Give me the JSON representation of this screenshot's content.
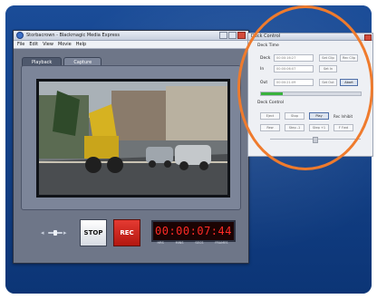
{
  "app": {
    "title": "Storbacrown - Blackmagic Media Express",
    "menu": [
      "File",
      "Edit",
      "View",
      "Movie",
      "Help"
    ],
    "tabs": [
      {
        "label": "Playback",
        "active": false
      },
      {
        "label": "Capture",
        "active": true
      }
    ]
  },
  "transport": {
    "stop_label": "STOP",
    "rec_label": "REC",
    "timecode": "00:00:07:44",
    "tc_labels": [
      "HRS",
      "MINS",
      "SECS",
      "FRAMES"
    ]
  },
  "deck": {
    "title": "Deck Control",
    "deck_time_header": "Deck Time",
    "deck_control_header": "Deck Control",
    "rows": [
      {
        "label": "Deck",
        "value": "00:00:16:27",
        "buttons": [
          "Set Clip",
          "Rec Clip"
        ]
      },
      {
        "label": "In",
        "value": "00:00:06:07",
        "buttons": [
          "Set In"
        ]
      },
      {
        "label": "Out",
        "value": "00:00:21:09",
        "buttons": [
          "Set Out",
          "Abort"
        ]
      }
    ],
    "progress": 0.22,
    "control_buttons_row1": [
      "Eject",
      "Stop",
      "Play"
    ],
    "rec_inhibit": "Rec Inhibit",
    "control_buttons_row2": [
      "Rew",
      "Step -1",
      "Step +1",
      "F Fwd"
    ]
  },
  "colors": {
    "background": "#0f3f86",
    "highlight_circle": "#ef7b2d",
    "timecode": "#ff2b26",
    "rec": "#d0241b",
    "progress": "#39b23c"
  }
}
